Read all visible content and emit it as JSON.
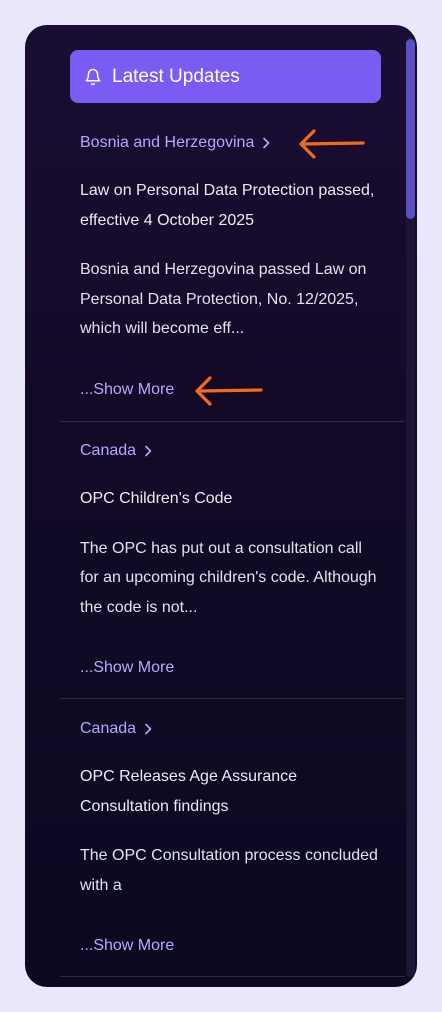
{
  "header": {
    "title": "Latest Updates",
    "icon": "bell-icon"
  },
  "updates": [
    {
      "country": "Bosnia and Herzegovina",
      "headline": "Law on Personal Data Protection passed, effective 4 October 2025",
      "summary": "Bosnia and Herzegovina passed Law on Personal Data Protection, No. 12/2025, which will become eff...",
      "more": "...Show More"
    },
    {
      "country": "Canada",
      "headline": "OPC Children's Code",
      "summary": "The OPC has put out a consultation call for an upcoming children's code. Although the code is not...",
      "more": "...Show More"
    },
    {
      "country": "Canada",
      "headline": "OPC Releases Age Assurance Consultation findings",
      "summary": "The OPC Consultation process concluded with a",
      "more": "...Show More"
    }
  ],
  "colors": {
    "accent": "#7a5cf5",
    "link": "#b6a6ff",
    "annotation_arrow": "#f26a1b",
    "background": "#eae7fb",
    "panel": "#120a26"
  }
}
